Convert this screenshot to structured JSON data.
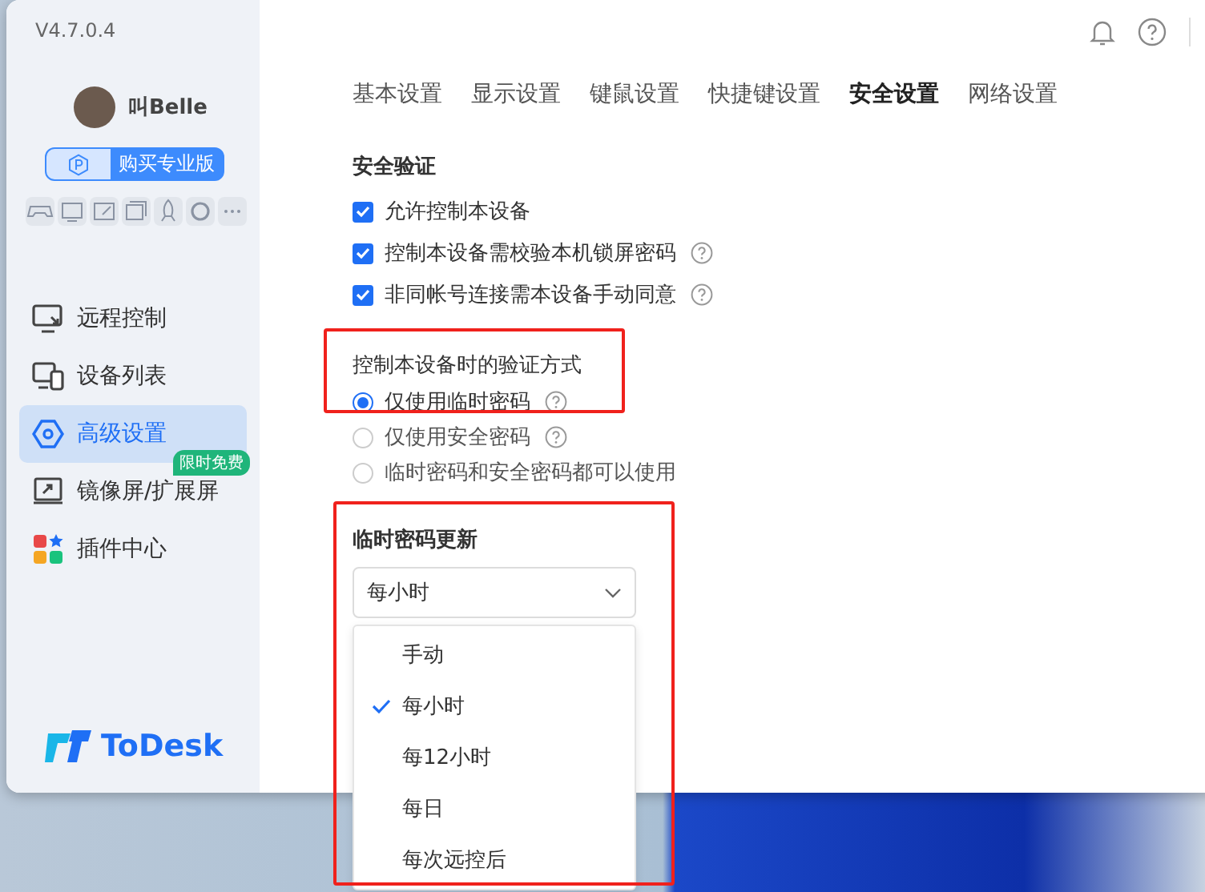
{
  "app": {
    "version": "V4.7.0.4",
    "logo_text": "ToDesk"
  },
  "user": {
    "name": "叫Belle",
    "upgrade_button": "购买专业版"
  },
  "nav": [
    {
      "label": "远程控制",
      "selected": false
    },
    {
      "label": "设备列表",
      "selected": false
    },
    {
      "label": "高级设置",
      "selected": true
    },
    {
      "label": "镜像屏/扩展屏",
      "selected": false,
      "badge": "限时免费"
    },
    {
      "label": "插件中心",
      "selected": false
    }
  ],
  "tabs": [
    {
      "label": "基本设置",
      "selected": false
    },
    {
      "label": "显示设置",
      "selected": false
    },
    {
      "label": "键鼠设置",
      "selected": false
    },
    {
      "label": "快捷键设置",
      "selected": false
    },
    {
      "label": "安全设置",
      "selected": true
    },
    {
      "label": "网络设置",
      "selected": false
    }
  ],
  "security_verification": {
    "title": "安全验证",
    "options": [
      {
        "label": "允许控制本设备",
        "checked": true,
        "help": false
      },
      {
        "label": "控制本设备需校验本机锁屏密码",
        "checked": true,
        "help": true
      },
      {
        "label": "非同帐号连接需本设备手动同意",
        "checked": true,
        "help": true
      }
    ]
  },
  "verification_method": {
    "title": "控制本设备时的验证方式",
    "options": [
      {
        "label": "仅使用临时密码",
        "selected": true,
        "help": true
      },
      {
        "label": "仅使用安全密码",
        "selected": false,
        "help": true
      },
      {
        "label": "临时密码和安全密码都可以使用",
        "selected": false,
        "help": false
      }
    ]
  },
  "temp_password_update": {
    "title": "临时密码更新",
    "select": {
      "value": "每小时"
    },
    "menu": [
      {
        "label": "手动",
        "selected": false
      },
      {
        "label": "每小时",
        "selected": true
      },
      {
        "label": "每12小时",
        "selected": false
      },
      {
        "label": "每日",
        "selected": false
      },
      {
        "label": "每次远控后",
        "selected": false
      }
    ]
  }
}
